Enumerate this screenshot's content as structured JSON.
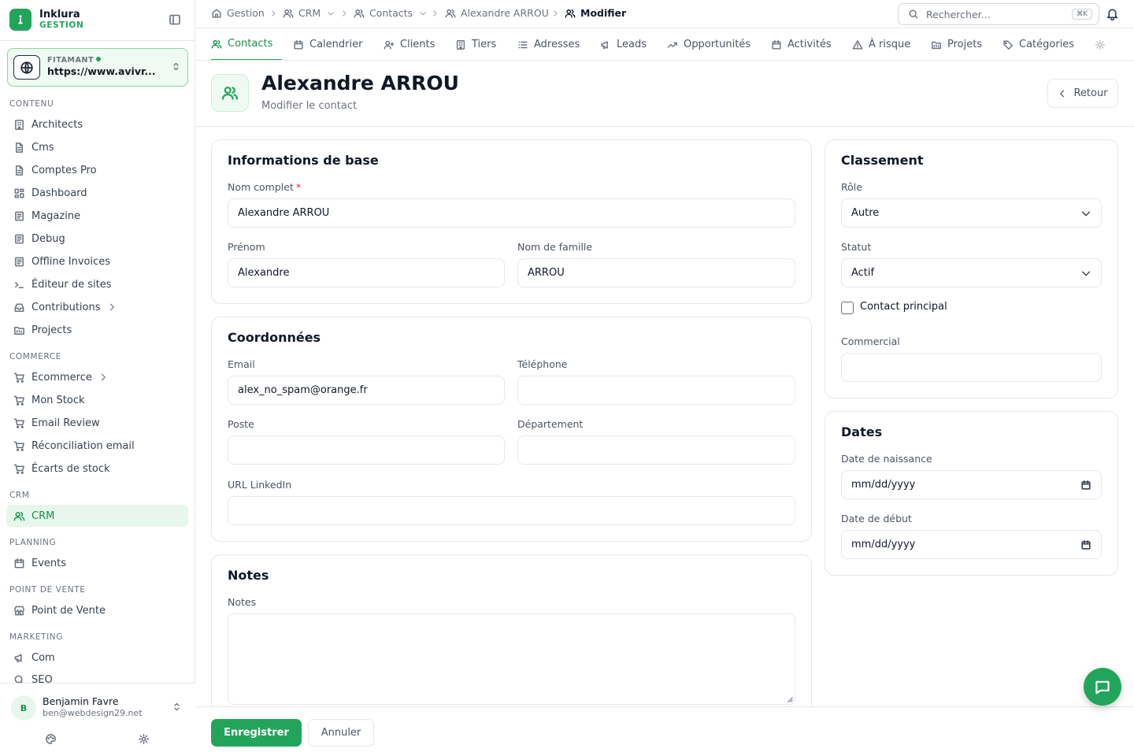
{
  "brand": {
    "name": "Inklura",
    "subtitle": "GESTION"
  },
  "site": {
    "label": "FITAMANT",
    "url": "https://www.avivr..."
  },
  "sidebar": {
    "sections": {
      "contenu": "CONTENU",
      "commerce": "COMMERCE",
      "crm": "CRM",
      "planning": "PLANNING",
      "pos": "POINT DE VENTE",
      "marketing": "MARKETING"
    },
    "items": {
      "architects": "Architects",
      "cms": "Cms",
      "comptes_pro": "Comptes Pro",
      "dashboard": "Dashboard",
      "magazine": "Magazine",
      "debug": "Debug",
      "offline_invoices": "Offline Invoices",
      "editeur": "Éditeur de sites",
      "contributions": "Contributions",
      "projects": "Projects",
      "ecommerce": "Ecommerce",
      "mon_stock": "Mon Stock",
      "email_review": "Email Review",
      "reconciliation": "Réconciliation email",
      "ecarts": "Écarts de stock",
      "crm": "CRM",
      "events": "Events",
      "point_vente": "Point de Vente",
      "com": "Com",
      "seo": "SEO"
    }
  },
  "user": {
    "initial": "B",
    "name": "Benjamin Favre",
    "email": "ben@webdesign29.net"
  },
  "breadcrumb": {
    "gestion": "Gestion",
    "crm": "CRM",
    "contacts": "Contacts",
    "contact": "Alexandre ARROU",
    "current": "Modifier"
  },
  "search": {
    "placeholder": "Rechercher...",
    "shortcut": "⌘K"
  },
  "tabs": {
    "contacts": "Contacts",
    "calendrier": "Calendrier",
    "clients": "Clients",
    "tiers": "Tiers",
    "adresses": "Adresses",
    "leads": "Leads",
    "opportunites": "Opportunités",
    "activites": "Activités",
    "risque": "À risque",
    "projets": "Projets",
    "categories": "Catégories"
  },
  "page": {
    "title": "Alexandre ARROU",
    "subtitle": "Modifier le contact",
    "back_label": "Retour"
  },
  "base_info": {
    "title": "Informations de base",
    "full_name_label": "Nom complet",
    "required_mark": "*",
    "full_name": "Alexandre ARROU",
    "first_name_label": "Prénom",
    "first_name": "Alexandre",
    "last_name_label": "Nom de famille",
    "last_name": "ARROU"
  },
  "coords": {
    "title": "Coordonnées",
    "email_label": "Email",
    "email": "alex_no_spam@orange.fr",
    "phone_label": "Téléphone",
    "phone": "",
    "poste_label": "Poste",
    "poste": "",
    "dept_label": "Département",
    "dept": "",
    "linkedin_label": "URL LinkedIn",
    "linkedin": ""
  },
  "notes": {
    "title": "Notes",
    "label": "Notes",
    "value": ""
  },
  "classement": {
    "title": "Classement",
    "role_label": "Rôle",
    "role": "Autre",
    "status_label": "Statut",
    "status": "Actif",
    "principal_label": "Contact principal",
    "principal_checked": false,
    "commercial_label": "Commercial",
    "commercial": ""
  },
  "dates": {
    "title": "Dates",
    "birth_label": "Date de naissance",
    "birth": "mm/dd/yyyy",
    "start_label": "Date de début",
    "start": "mm/dd/yyyy"
  },
  "actions": {
    "save": "Enregistrer",
    "cancel": "Annuler"
  },
  "colors": {
    "accent": "#22a55b",
    "accent_text": "#16934a",
    "accent_bg": "#e8f7ee",
    "required": "#dc2626"
  }
}
